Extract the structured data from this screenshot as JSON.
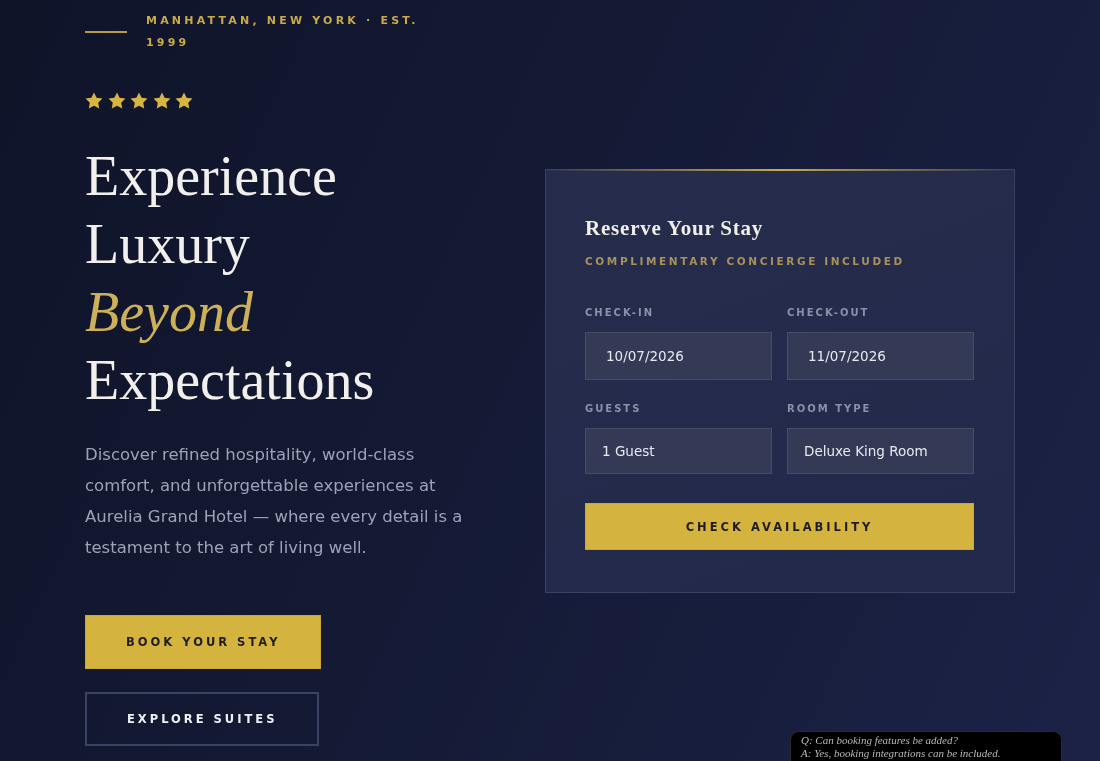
{
  "hero": {
    "tagline": "MANHATTAN, NEW YORK · EST. 1999",
    "rating": {
      "stars": 5
    },
    "title": "Experience Luxury *Beyond* Expectations",
    "description": "Discover refined hospitality, world-class comfort, and unforgettable experiences at Aurelia Grand Hotel — where every detail is a testament to the art of living well.",
    "buttons": [
      {
        "label": "BOOK YOUR STAY",
        "kind": "primary"
      },
      {
        "label": "EXPLORE SUITES",
        "kind": "outline"
      }
    ]
  },
  "booking_form": {
    "title": "Reserve Your Stay",
    "subtitle": "COMPLIMENTARY CONCIERGE INCLUDED",
    "fields": [
      {
        "label": "CHECK-IN",
        "value": "10/07/2026",
        "kind": "date"
      },
      {
        "label": "CHECK-OUT",
        "value": "11/07/2026",
        "kind": "date"
      },
      {
        "label": "GUESTS",
        "value": "1 Guest",
        "kind": "select"
      },
      {
        "label": "ROOM TYPE",
        "value": "Deluxe King Room",
        "kind": "select"
      }
    ],
    "submit": "CHECK AVAILABILITY"
  },
  "chat_popup": {
    "lines": [
      "Q: Can booking features be added?",
      "A: Yes, booking integrations can be included."
    ]
  }
}
